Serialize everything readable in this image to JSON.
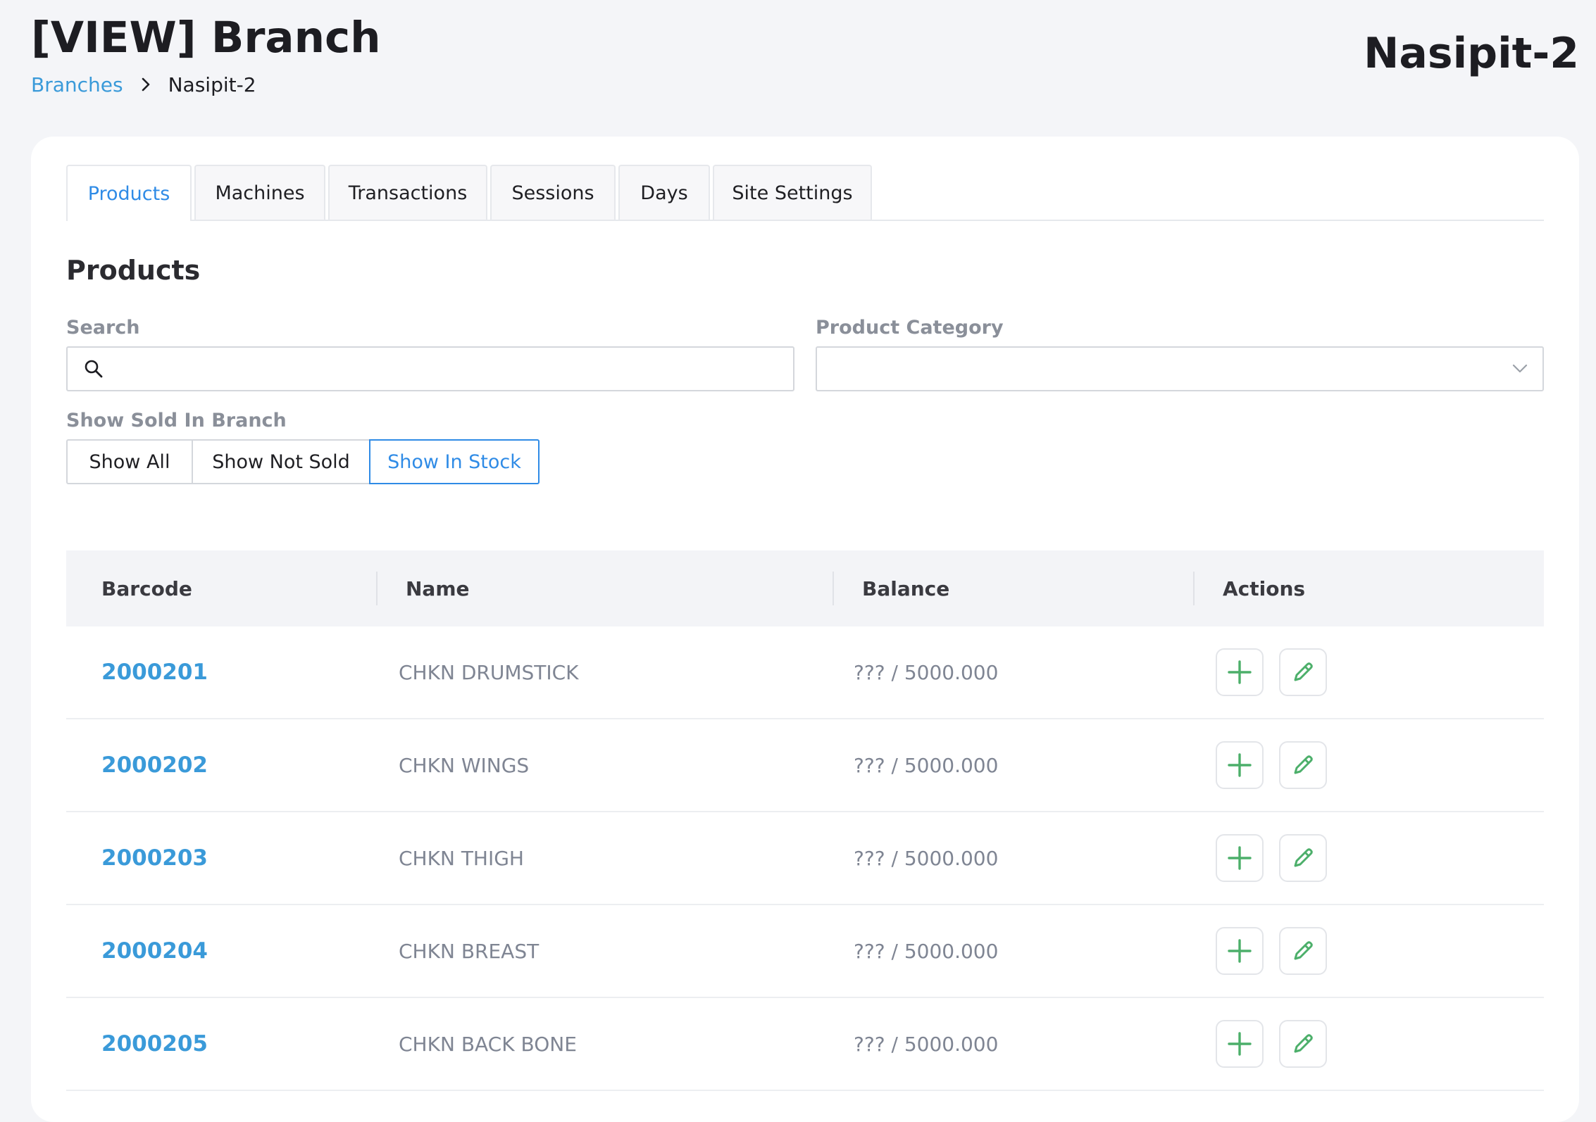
{
  "header": {
    "title": "[VIEW] Branch",
    "branch_name": "Nasipit-2"
  },
  "breadcrumb": {
    "parent": "Branches",
    "current": "Nasipit-2"
  },
  "tabs": [
    {
      "label": "Products",
      "active": true
    },
    {
      "label": "Machines",
      "active": false
    },
    {
      "label": "Transactions",
      "active": false
    },
    {
      "label": "Sessions",
      "active": false
    },
    {
      "label": "Days",
      "active": false
    },
    {
      "label": "Site Settings",
      "active": false
    }
  ],
  "section": {
    "title": "Products"
  },
  "filters": {
    "search_label": "Search",
    "search_value": "",
    "category_label": "Product Category",
    "category_value": "",
    "sold_label": "Show Sold In Branch",
    "sold_options": [
      "Show All",
      "Show Not Sold",
      "Show In Stock"
    ],
    "sold_selected": "Show In Stock"
  },
  "table": {
    "columns": [
      "Barcode",
      "Name",
      "Balance",
      "Actions"
    ],
    "rows": [
      {
        "barcode": "2000201",
        "name": "CHKN DRUMSTICK",
        "balance": "??? / 5000.000"
      },
      {
        "barcode": "2000202",
        "name": "CHKN WINGS",
        "balance": "??? / 5000.000"
      },
      {
        "barcode": "2000203",
        "name": "CHKN THIGH",
        "balance": "??? / 5000.000"
      },
      {
        "barcode": "2000204",
        "name": "CHKN BREAST",
        "balance": "??? / 5000.000"
      },
      {
        "barcode": "2000205",
        "name": "CHKN BACK BONE",
        "balance": "??? / 5000.000"
      }
    ]
  },
  "icons": {
    "search": "search-icon",
    "dropdown": "chevron-down-icon",
    "breadcrumb_separator": "chevron-right-icon",
    "add": "plus-icon",
    "edit": "pencil-icon"
  },
  "colors": {
    "accent": "#2f8be6",
    "link": "#3a9ad9",
    "action_icon": "#4caf6a",
    "page_bg": "#f4f5f8"
  }
}
